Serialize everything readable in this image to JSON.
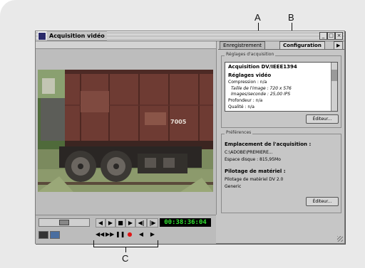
{
  "callouts": {
    "a": "A",
    "b": "B",
    "c": "C"
  },
  "window": {
    "title": "Acquisition vidéo",
    "minimize": "_",
    "maximize": "□",
    "close": "×"
  },
  "tabs": {
    "recording": "Enregistrement",
    "settings": "Configuration",
    "more": "▶"
  },
  "controls": {
    "timecode": "00:38:36:04",
    "transport_top": [
      "◀",
      "▶",
      "■",
      "▶",
      "◀|",
      "|▶"
    ],
    "transport_bottom": [
      "◀◀",
      "▶▶",
      "❚❚",
      "●",
      "◀",
      "▶"
    ]
  },
  "capture": {
    "group_title": "Réglages d'acquisition",
    "heading": "Acquisition DV/IEEE1394",
    "sub_heading": "Réglages vidéo",
    "compression": "Compression : n/a",
    "frame_size": "Taille de l'image : 720 x 576",
    "frame_rate": "Images/seconde : 25,00 IPS",
    "depth": "Profondeur : n/a",
    "quality": "Qualité : n/a",
    "edit_button": "Éditeur..."
  },
  "prefs": {
    "group_title": "Préférences",
    "location_heading": "Emplacement de l'acquisition :",
    "location_path": "C:\\ADOBE\\PREMIERE...",
    "disk_space": "Espace disque : 815,95Mo",
    "device_heading": "Pilotage de matériel :",
    "device_name": "Pilotage de matériel DV 2.0",
    "device_generic": "Generic",
    "edit_button": "Éditeur..."
  },
  "video_overlay_text": "7005",
  "colors": {
    "timecode": "#30e030",
    "record": "#e01818",
    "boxcar": "#6e3b33"
  }
}
